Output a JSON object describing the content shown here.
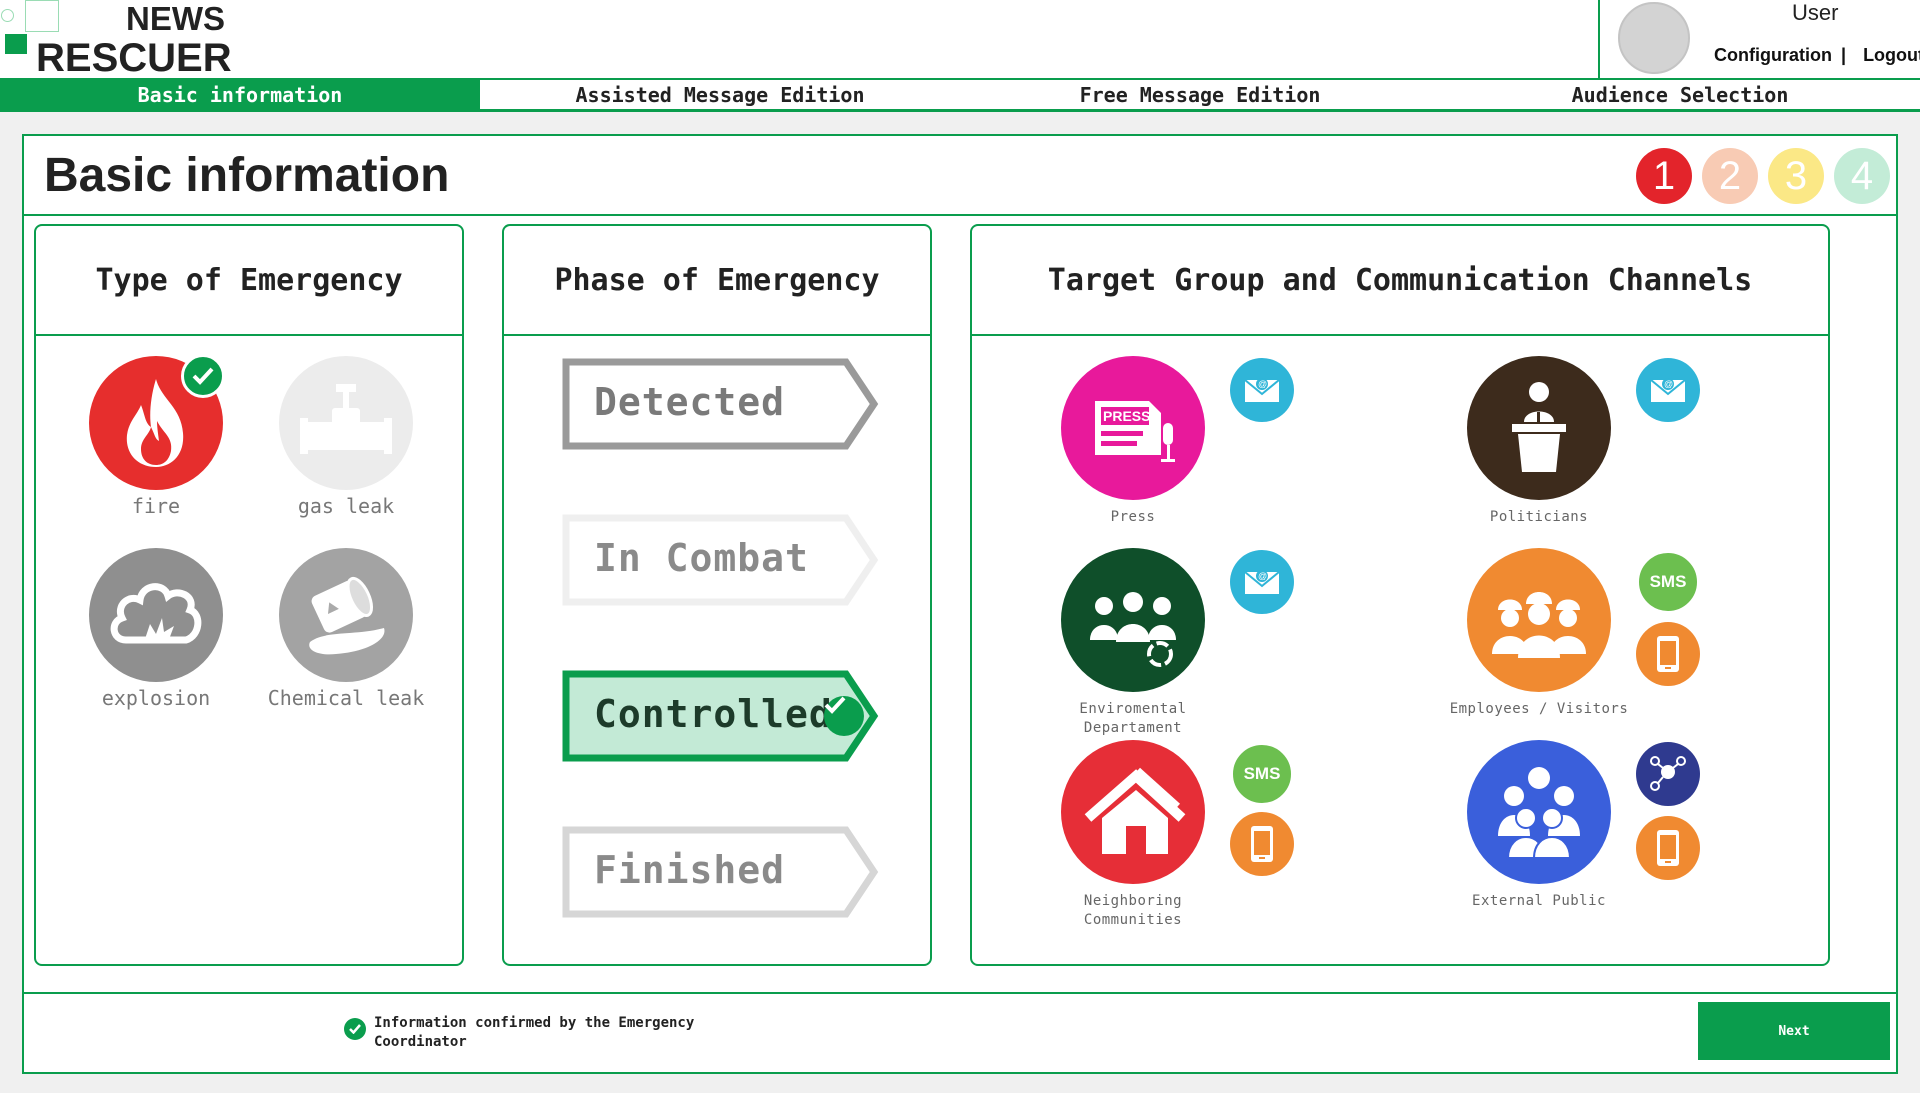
{
  "brand": {
    "line1": "NEWS",
    "line2": "RESCUER",
    "accent_color": "#0a9d4d"
  },
  "user": {
    "name": "User",
    "configuration_label": "Configuration",
    "separator": "|",
    "logout_label": "Logout",
    "avatar_icon": "avatar-placeholder"
  },
  "tabs": [
    {
      "label": "Basic information",
      "active": true
    },
    {
      "label": "Assisted Message Edition",
      "active": false
    },
    {
      "label": "Free Message Edition",
      "active": false
    },
    {
      "label": "Audience Selection",
      "active": false
    }
  ],
  "page": {
    "title": "Basic information",
    "steps": [
      {
        "label": "1",
        "color": "#e3242b",
        "current": true
      },
      {
        "label": "2",
        "color": "#f8cbb4",
        "current": false
      },
      {
        "label": "3",
        "color": "#fbe886",
        "current": false
      },
      {
        "label": "4",
        "color": "#c3ecd7",
        "current": false
      }
    ]
  },
  "emergency_type": {
    "title": "Type of Emergency",
    "items": [
      {
        "label": "fire",
        "icon": "fire-icon",
        "color": "#e62e2d",
        "selected": true
      },
      {
        "label": "gas leak",
        "icon": "gas-valve-icon",
        "color": "#ececec",
        "selected": false
      },
      {
        "label": "explosion",
        "icon": "explosion-icon",
        "color": "#8f8f8f",
        "selected": false
      },
      {
        "label": "Chemical leak",
        "icon": "chemical-barrel-icon",
        "color": "#a3a3a3",
        "selected": false
      }
    ]
  },
  "emergency_phase": {
    "title": "Phase of Emergency",
    "items": [
      {
        "label": "Detected",
        "state": "available"
      },
      {
        "label": "In Combat",
        "state": "disabled"
      },
      {
        "label": "Controlled",
        "state": "selected"
      },
      {
        "label": "Finished",
        "state": "available-light"
      }
    ]
  },
  "targets": {
    "title": "Target Group and Communication Channels",
    "groups": [
      {
        "label": "Press",
        "icon": "press-icon",
        "color": "#e8199b",
        "channels": [
          "email"
        ]
      },
      {
        "label": "Politicians",
        "icon": "podium-speaker-icon",
        "color": "#3d2b1c",
        "channels": [
          "email"
        ]
      },
      {
        "label": "Enviromental Departament",
        "icon": "environment-team-icon",
        "color": "#0f4f2a",
        "channels": [
          "email"
        ]
      },
      {
        "label": "Employees / Visitors",
        "icon": "workers-icon",
        "color": "#f08a31",
        "channels": [
          "sms",
          "app"
        ]
      },
      {
        "label": "Neighboring Communities",
        "icon": "house-icon",
        "color": "#e62e37",
        "channels": [
          "sms",
          "app"
        ]
      },
      {
        "label": "External Public",
        "icon": "crowd-icon",
        "color": "#3a5fdb",
        "channels": [
          "social",
          "app"
        ]
      }
    ],
    "channel_labels": {
      "sms": "SMS"
    },
    "channel_colors": {
      "email": "#2fb5d8",
      "sms": "#6cbf4f",
      "app": "#f08a31",
      "social": "#2f3a8f"
    }
  },
  "footer": {
    "confirmation_text": "Information confirmed by the Emergency Coordinator",
    "next_label": "Next"
  }
}
